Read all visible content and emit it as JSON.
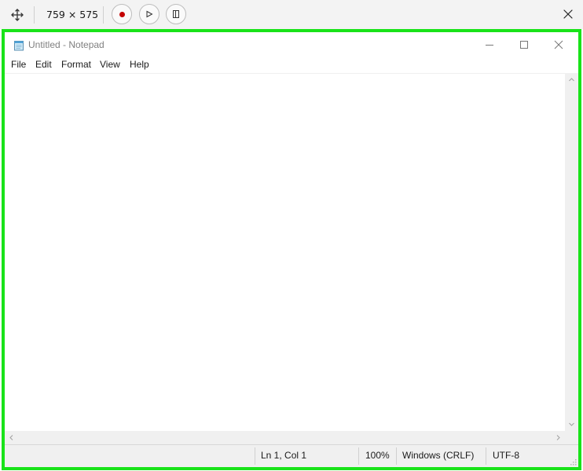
{
  "capture_toolbar": {
    "move_icon": "move-icon",
    "size_label": "759 × 575",
    "record_icon": "record-icon",
    "play_icon": "play-icon",
    "frame_icon": "frame-icon",
    "close_icon": "close-icon",
    "record_color": "#c40000",
    "selection_color": "#19e319"
  },
  "window": {
    "title": "Untitled - Notepad",
    "app_icon": "notepad-icon",
    "controls": [
      "minimize",
      "maximize",
      "close"
    ]
  },
  "menu": {
    "items": [
      {
        "label": "File"
      },
      {
        "label": "Edit"
      },
      {
        "label": "Format"
      },
      {
        "label": "View"
      },
      {
        "label": "Help"
      }
    ]
  },
  "editor": {
    "content": ""
  },
  "statusbar": {
    "position": "Ln 1, Col 1",
    "zoom": "100%",
    "line_ending": "Windows (CRLF)",
    "encoding": "UTF-8"
  }
}
